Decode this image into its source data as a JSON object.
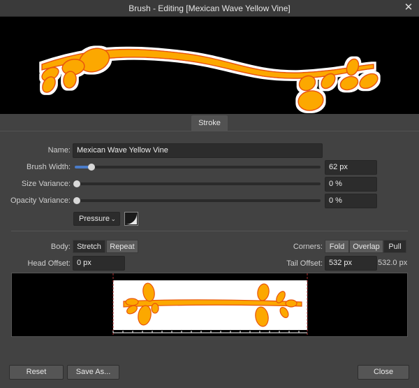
{
  "window": {
    "title": "Brush - Editing [Mexican Wave Yellow Vine]"
  },
  "tabs": [
    {
      "label": "Stroke"
    }
  ],
  "fields": {
    "name_label": "Name:",
    "name_value": "Mexican Wave Yellow Vine",
    "brush_width_label": "Brush Width:",
    "brush_width_value": "62 px",
    "brush_width_level": 0.06,
    "size_variance_label": "Size Variance:",
    "size_variance_value": "0 %",
    "size_variance_level": 0,
    "opacity_variance_label": "Opacity Variance:",
    "opacity_variance_value": "0 %",
    "opacity_variance_level": 0,
    "controller": "Pressure"
  },
  "body": {
    "label": "Body:",
    "options": [
      "Stretch",
      "Repeat"
    ],
    "selected": "Stretch"
  },
  "corners": {
    "label": "Corners:",
    "options": [
      "Fold",
      "Overlap",
      "Pull"
    ],
    "selected": "Pull"
  },
  "offsets": {
    "head_label": "Head Offset:",
    "head_value": "0 px",
    "tail_label": "Tail Offset:",
    "tail_value": "532 px",
    "total_px": "532.0 px"
  },
  "buttons": {
    "reset": "Reset",
    "save_as": "Save As...",
    "close": "Close"
  },
  "icons": {
    "close": "close-icon",
    "dropdown": "chevron-down-icon",
    "curve": "pressure-curve-icon"
  },
  "colors": {
    "accent": "#4b7cc9",
    "vine_fill": "#fca800",
    "vine_edge": "#e8540b"
  }
}
